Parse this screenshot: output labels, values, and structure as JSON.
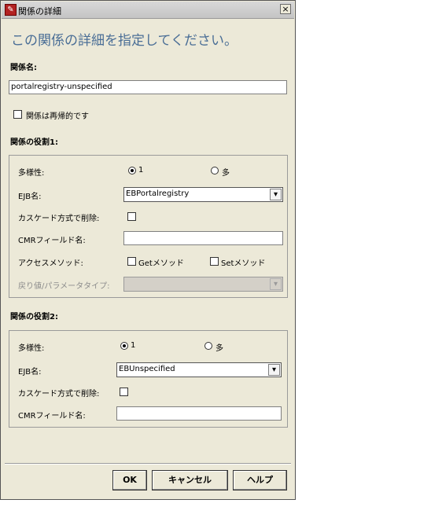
{
  "window": {
    "title": "関係の詳細",
    "heading": "この関係の詳細を指定してください。",
    "close_glyph": "×"
  },
  "relation_name": {
    "label": "関係名:",
    "value": "portalregistry-unspecified"
  },
  "reflexive_checkbox": {
    "label": "関係は再帰的です",
    "checked": false
  },
  "role1": {
    "header": "関係の役割1:",
    "multiplicity_label": "多様性:",
    "multiplicity_options": [
      "1",
      "多"
    ],
    "multiplicity_selected": "1",
    "ejb_label": "EJB名:",
    "ejb_value": "EBPortalregistry",
    "cascade_label": "カスケード方式で削除:",
    "cascade_checked": false,
    "cmr_label": "CMRフィールド名:",
    "cmr_value": "",
    "access_label": "アクセスメソッド:",
    "get_label": "Getメソッド",
    "set_label": "Setメソッド",
    "return_type_label": "戻り値/パラメータタイプ:",
    "return_type_value": ""
  },
  "role2": {
    "header": "関係の役割2:",
    "multiplicity_label": "多様性:",
    "multiplicity_options": [
      "1",
      "多"
    ],
    "multiplicity_selected": "1",
    "ejb_label": "EJB名:",
    "ejb_value": "EBUnspecified",
    "cascade_label": "カスケード方式で削除:",
    "cascade_checked": false,
    "cmr_label": "CMRフィールド名:",
    "cmr_value": ""
  },
  "buttons": {
    "ok": "OK",
    "cancel": "キャンセル",
    "help": "ヘルプ"
  },
  "colors": {
    "dialog_bg": "#ece9d8",
    "heading": "#4a6e96"
  },
  "icons": {
    "app": "dialog-app-icon",
    "close": "close-icon",
    "dropdown": "chevron-down-icon"
  }
}
